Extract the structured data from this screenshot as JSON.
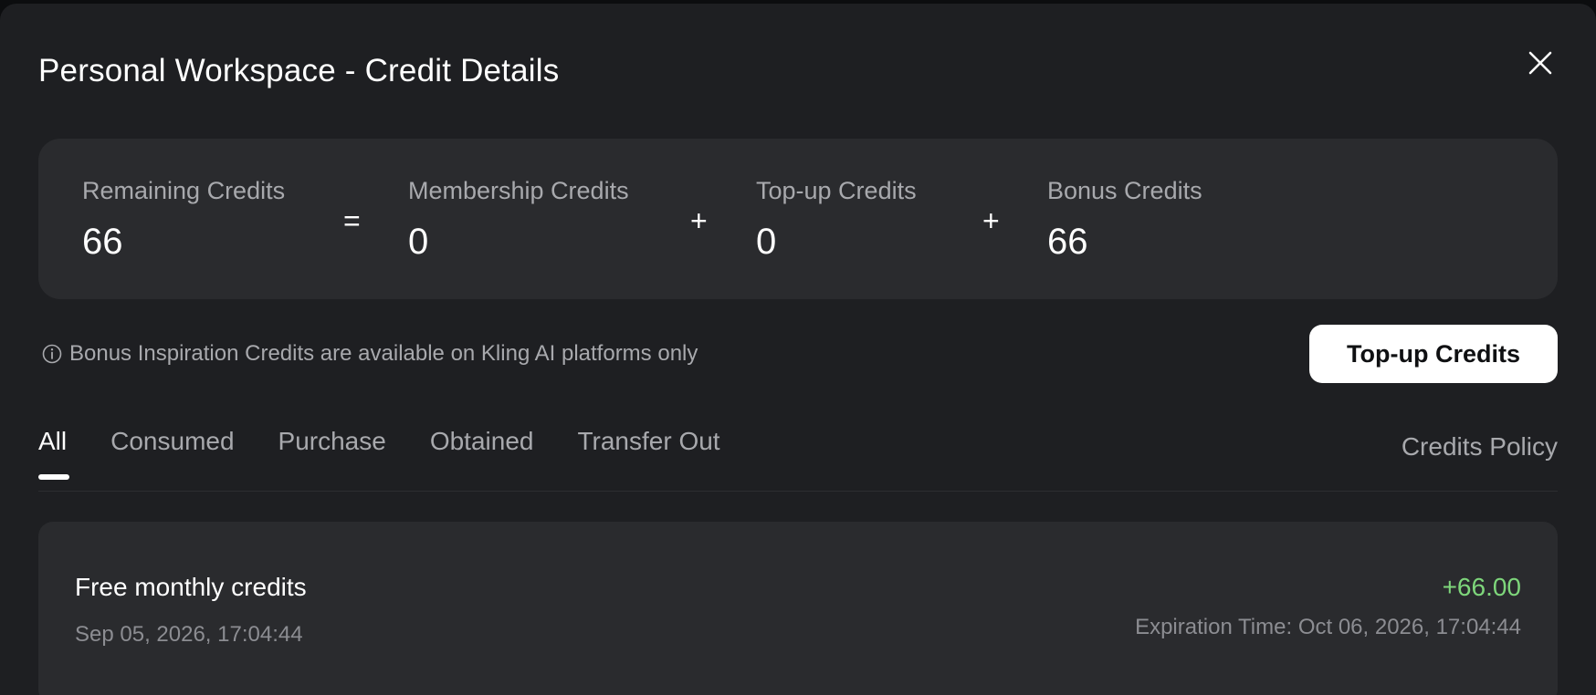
{
  "header": {
    "title": "Personal Workspace - Credit Details"
  },
  "summary": {
    "remaining": {
      "label": "Remaining Credits",
      "value": "66"
    },
    "equals_sign": "=",
    "membership": {
      "label": "Membership Credits",
      "value": "0"
    },
    "plus_sign_1": "+",
    "topup": {
      "label": "Top-up Credits",
      "value": "0"
    },
    "plus_sign_2": "+",
    "bonus": {
      "label": "Bonus Credits",
      "value": "66"
    }
  },
  "notice": {
    "text": "Bonus Inspiration Credits are available on Kling AI platforms only"
  },
  "actions": {
    "topup_button": "Top-up Credits",
    "policy_link": "Credits Policy"
  },
  "tabs": [
    {
      "label": "All",
      "active": true
    },
    {
      "label": "Consumed",
      "active": false
    },
    {
      "label": "Purchase",
      "active": false
    },
    {
      "label": "Obtained",
      "active": false
    },
    {
      "label": "Transfer Out",
      "active": false
    }
  ],
  "records": [
    {
      "title": "Free monthly credits",
      "date": "Sep 05, 2026, 17:04:44",
      "amount": "+66.00",
      "expiration": "Expiration Time: Oct 06, 2026, 17:04:44"
    }
  ],
  "colors": {
    "modal_bg": "#1e1f22",
    "card_bg": "#2a2b2e",
    "positive": "#7ed67b",
    "muted_text": "#a8a9ad"
  },
  "icons": {
    "close": "close-icon",
    "info": "info-icon"
  }
}
